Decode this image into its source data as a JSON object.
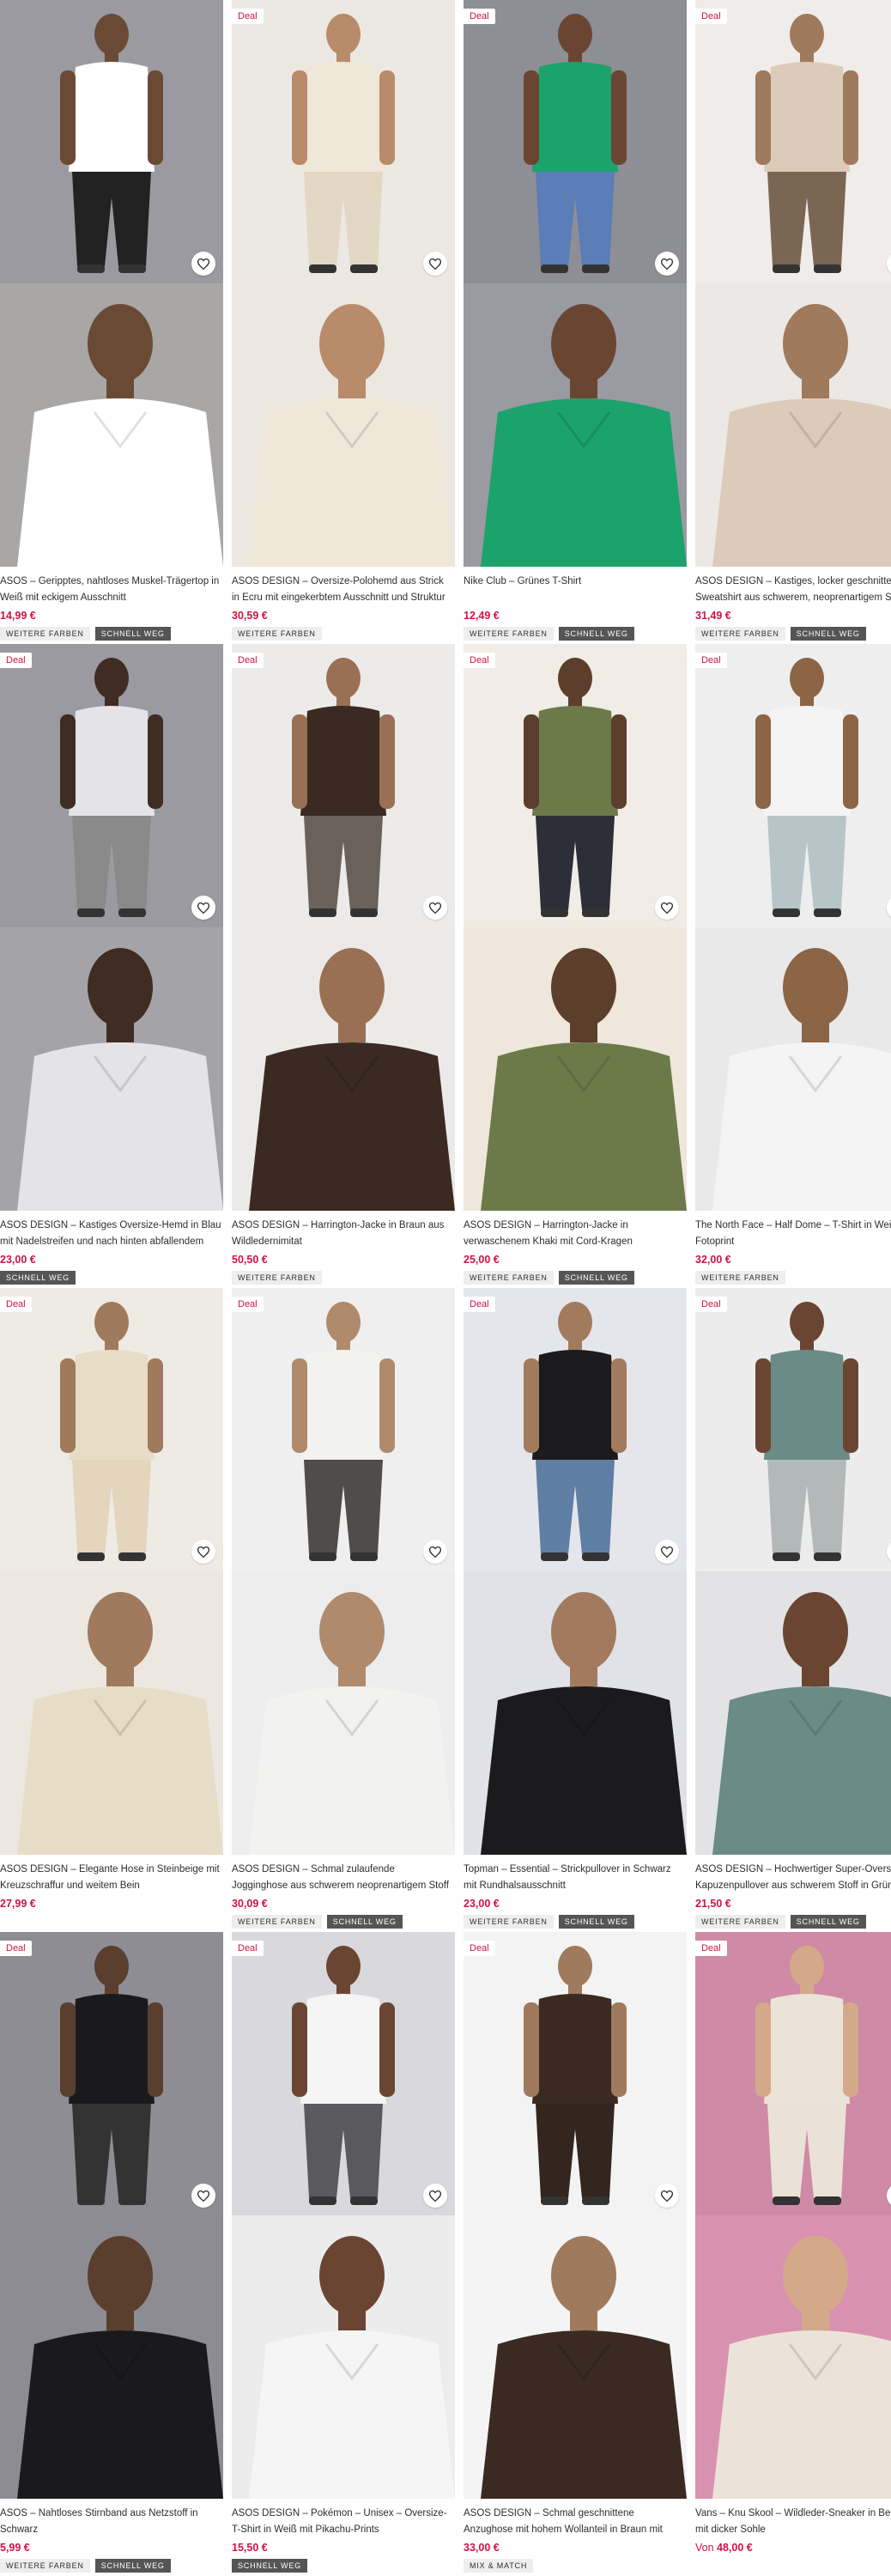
{
  "deal_label": "Deal",
  "badges": {
    "more_colors": "Weitere Farben",
    "fast": "Schnell weg",
    "mix": "Mix & Match"
  },
  "products": [
    {
      "deal": false,
      "title": "ASOS – Geripptes, nahtloses Muskel-Trägertop in Weiß mit eckigem Ausschnitt",
      "price": "14,99 €",
      "badges": [
        "more_colors",
        "fast"
      ],
      "bg_top": "#9a9aa0",
      "bg_bottom": "#a8a7a6",
      "garment": "#ffffff",
      "bottom_garment": "#222222",
      "skin": "#6b4a35"
    },
    {
      "deal": true,
      "title": "ASOS DESIGN – Oversize-Polohemd aus Strick in Ecru mit eingekerbtem Ausschnitt und Struktur",
      "price": "30,59 €",
      "badges": [
        "more_colors"
      ],
      "bg_top": "#ece8e2",
      "bg_bottom": "#ece7e0",
      "garment": "#efe8d8",
      "bottom_garment": "#e2d8c4",
      "skin": "#b88b6a"
    },
    {
      "deal": true,
      "title": "Nike Club – Grünes T-Shirt",
      "price": "12,49 €",
      "badges": [
        "more_colors",
        "fast"
      ],
      "bg_top": "#8e8e95",
      "bg_bottom": "#9a9aa2",
      "garment": "#1aa36a",
      "bottom_garment": "#5b7db8",
      "skin": "#6a4632"
    },
    {
      "deal": true,
      "title": "ASOS DESIGN – Kastiges, locker geschnittenes Sweatshirt aus schwerem, neoprenartigem Stoff",
      "price": "31,49 €",
      "badges": [
        "more_colors",
        "fast"
      ],
      "bg_top": "#f0ecea",
      "bg_bottom": "#ece8e6",
      "garment": "#dccbb8",
      "bottom_garment": "#7b6654",
      "skin": "#a07a5c"
    },
    {
      "deal": true,
      "title": "ASOS DESIGN – Kastiges Oversize-Hemd in Blau mit Nadelstreifen und nach hinten abfallendem Saum",
      "price": "23,00 €",
      "badges": [
        "fast"
      ],
      "bg_top": "#9b9aa0",
      "bg_bottom": "#a4a3a8",
      "garment": "#e4e4e8",
      "bottom_garment": "#8a8a8a",
      "skin": "#3f2c22"
    },
    {
      "deal": true,
      "title": "ASOS DESIGN – Harrington-Jacke in Braun aus Wildledernimitat",
      "price": "50,50 €",
      "badges": [
        "more_colors"
      ],
      "bg_top": "#ecebe9",
      "bg_bottom": "#ebeae8",
      "garment": "#3b2a22",
      "bottom_garment": "#6a625a",
      "skin": "#9a7054"
    },
    {
      "deal": true,
      "title": "ASOS DESIGN – Harrington-Jacke in verwaschenem Khaki mit Cord-Kragen",
      "price": "25,00 €",
      "badges": [
        "more_colors",
        "fast"
      ],
      "bg_top": "#f1ece6",
      "bg_bottom": "#efe7dc",
      "garment": "#6c7a4a",
      "bottom_garment": "#2d2f38",
      "skin": "#5b3e2c"
    },
    {
      "deal": true,
      "title": "The North Face – Half Dome – T-Shirt in Weiß mit Fotoprint",
      "price": "32,00 €",
      "badges": [
        "more_colors"
      ],
      "bg_top": "#eeeeee",
      "bg_bottom": "#e9e9e9",
      "garment": "#f4f4f4",
      "bottom_garment": "#b7c5c8",
      "skin": "#8c6546"
    },
    {
      "deal": true,
      "title": "ASOS DESIGN – Elegante Hose in Steinbeige mit Kreuzschraffur und weitem Bein",
      "price": "27,99 €",
      "badges": [],
      "bg_top": "#eeeae4",
      "bg_bottom": "#ece7e0",
      "garment": "#e7dcc6",
      "bottom_garment": "#e3d6bd",
      "skin": "#a07a5c"
    },
    {
      "deal": true,
      "title": "ASOS DESIGN – Schmal zulaufende Jogginghose aus schwerem neoprenartigem Stoff in Anthrazit mit...",
      "price": "30,09 €",
      "badges": [
        "more_colors",
        "fast"
      ],
      "bg_top": "#efefef",
      "bg_bottom": "#ededed",
      "garment": "#f2f2f0",
      "bottom_garment": "#4f4c4a",
      "skin": "#b08a6c"
    },
    {
      "deal": true,
      "title": "Topman – Essential – Strickpullover in Schwarz mit Rundhalsausschnitt",
      "price": "23,00 €",
      "badges": [
        "more_colors",
        "fast"
      ],
      "bg_top": "#e4e6ec",
      "bg_bottom": "#e0e2e8",
      "garment": "#1b1b1d",
      "bottom_garment": "#5f7ea4",
      "skin": "#a27b5e"
    },
    {
      "deal": true,
      "title": "ASOS DESIGN – Hochwertiger Super-Oversize-Kapuzenpullover aus schwerem Stoff in Grün, ...",
      "price": "21,50 €",
      "badges": [
        "more_colors",
        "fast"
      ],
      "bg_top": "#ececec",
      "bg_bottom": "#e3e3e5",
      "garment": "#6a8b86",
      "bottom_garment": "#b3b8b8",
      "skin": "#6a4632"
    },
    {
      "deal": true,
      "title": "ASOS – Nahtloses Stirnband aus Netzstoff in Schwarz",
      "price": "5,99 €",
      "badges": [
        "more_colors",
        "fast"
      ],
      "bg_top": "#8e8d93",
      "bg_bottom": "#8d8c92",
      "garment": "#1a1a1e",
      "bottom_garment": "#333333",
      "skin": "#5a3e2e"
    },
    {
      "deal": true,
      "title": "ASOS DESIGN – Pokémon – Unisex – Oversize-T-Shirt in Weiß mit Pikachu-Prints",
      "price": "15,50 €",
      "badges": [
        "fast"
      ],
      "bg_top": "#d9d8dc",
      "bg_bottom": "#ececec",
      "garment": "#f5f5f5",
      "bottom_garment": "#5a5a5e",
      "skin": "#6a4632"
    },
    {
      "deal": true,
      "title": "ASOS DESIGN – Schmal geschnittene Anzughose mit hohem Wollanteil in Braun mit Fischgrätmuster",
      "price": "33,00 €",
      "badges": [
        "mix"
      ],
      "bg_top": "#f3f3f3",
      "bg_bottom": "#f4f4f4",
      "garment": "#3a2a22",
      "bottom_garment": "#33261f",
      "skin": "#a07a5c"
    },
    {
      "deal": true,
      "title": "Vans – Knu Skool – Wildleder-Sneaker in Beige mit dicker Sohle",
      "price_prefix": "Von",
      "price": "48,00 €",
      "badges": [],
      "bg_top": "#cf8aa6",
      "bg_bottom": "#d892b0",
      "garment": "#ece3d8",
      "bottom_garment": "#eae2d6",
      "skin": "#d4a98a"
    }
  ]
}
